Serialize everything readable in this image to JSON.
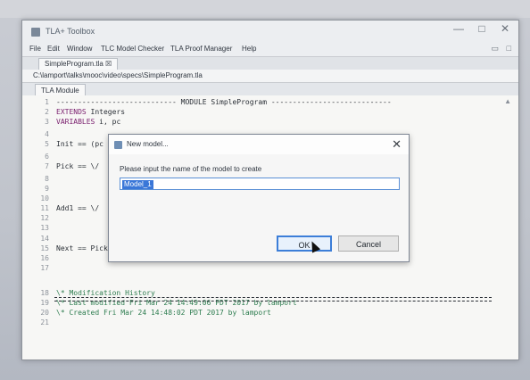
{
  "app": {
    "title": "TLA+ Toolbox",
    "menu": [
      "File",
      "Edit",
      "Window",
      "TLC Model Checker",
      "TLA Proof Manager",
      "Help"
    ],
    "window_controls": {
      "minimize": "—",
      "maximize": "□",
      "close": "✕"
    }
  },
  "editor_tab": {
    "label": "SimpleProgram.tla ☒"
  },
  "breadcrumb": {
    "path": "C:\\lamport\\talks\\mooc\\video\\specs\\SimpleProgram.tla"
  },
  "module_tab": {
    "label": "TLA Module"
  },
  "code": [
    {
      "n": "1",
      "text": "---------------------------- MODULE SimpleProgram ----------------------------"
    },
    {
      "n": "2",
      "kw": "EXTENDS",
      "text": " Integers"
    },
    {
      "n": "3",
      "kw": "VARIABLES",
      "text": " i, pc"
    },
    {
      "n": "4",
      "text": ""
    },
    {
      "n": "5",
      "text": "Init == (pc"
    },
    {
      "n": "6",
      "text": ""
    },
    {
      "n": "7",
      "text": "Pick == \\/"
    },
    {
      "n": "8",
      "text": ""
    },
    {
      "n": "9",
      "text": ""
    },
    {
      "n": "10",
      "text": ""
    },
    {
      "n": "11",
      "text": "Add1 == \\/"
    },
    {
      "n": "12",
      "text": ""
    },
    {
      "n": "13",
      "text": ""
    },
    {
      "n": "14",
      "text": ""
    },
    {
      "n": "15",
      "text": "Next == Pick \\/ Add1"
    },
    {
      "n": "16",
      "text": ""
    },
    {
      "n": "17",
      "text": ""
    },
    {
      "n": "18",
      "cm": "\\* Modification History"
    },
    {
      "n": "19",
      "cm": "\\* Last modified Fri Mar 24 14:49:06 PDT 2017 by lamport"
    },
    {
      "n": "20",
      "cm": "\\* Created Fri Mar 24 14:48:02 PDT 2017 by lamport"
    },
    {
      "n": "21",
      "text": ""
    }
  ],
  "dialog": {
    "title": "New model...",
    "prompt": "Please input the name of the model to create",
    "input_value": "Model_1",
    "ok_label": "OK",
    "cancel_label": "Cancel",
    "close_glyph": "✕"
  },
  "colors": {
    "keyword": "#7a1f6e",
    "comment": "#2e7d50",
    "selection": "#3a77d8",
    "default_button_border": "#3c7ed8"
  }
}
